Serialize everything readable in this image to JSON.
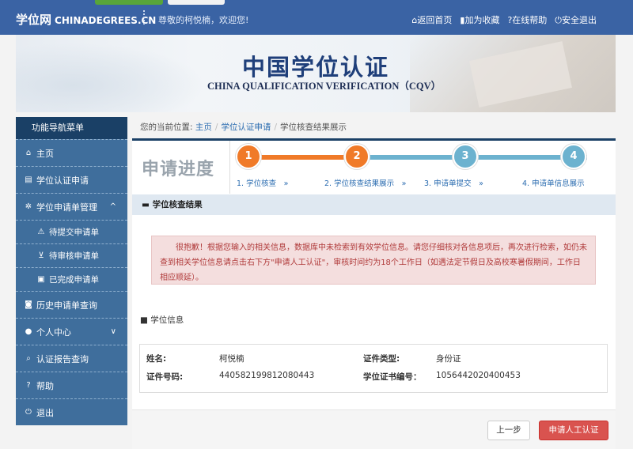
{
  "header": {
    "logo_cn": "学位网",
    "logo_en": "CHINADEGREES.CN",
    "greeting": "尊敬的柯悦楠，欢迎您!",
    "links": [
      {
        "icon": "home-icon",
        "glyph": "⌂",
        "label": "返回首页"
      },
      {
        "icon": "bookmark-icon",
        "glyph": "▮",
        "label": "加为收藏"
      },
      {
        "icon": "help-icon",
        "glyph": "?",
        "label": "在线帮助"
      },
      {
        "icon": "power-icon",
        "glyph": "⏻",
        "label": "安全退出"
      }
    ]
  },
  "banner": {
    "title_cn": "中国学位认证",
    "title_en": "CHINA QUALIFICATION VERIFICATION（CQV）"
  },
  "sidebar": {
    "heading": "功能导航菜单",
    "items": [
      {
        "label": "主页",
        "icon": "home-icon",
        "glyph": "⌂"
      },
      {
        "label": "学位认证申请",
        "icon": "document-icon",
        "glyph": "▤"
      },
      {
        "label": "学位申请单管理",
        "icon": "gear-icon",
        "glyph": "✲",
        "chevron": "^"
      },
      {
        "label": "待提交申请单",
        "icon": "warning-icon",
        "glyph": "⚠"
      },
      {
        "label": "待审核申请单",
        "icon": "cart-icon",
        "glyph": "⊻"
      },
      {
        "label": "已完成申请单",
        "icon": "briefcase-icon",
        "glyph": "▣"
      },
      {
        "label": "历史申请单查询",
        "icon": "camera-icon",
        "glyph": "◙"
      },
      {
        "label": "个人中心",
        "icon": "user-icon",
        "glyph": "●",
        "chevron": "∨"
      },
      {
        "label": "认证报告查询",
        "icon": "search-icon",
        "glyph": "⌕"
      },
      {
        "label": "帮助",
        "icon": "question-icon",
        "glyph": "?"
      },
      {
        "label": "退出",
        "icon": "power-icon",
        "glyph": "⏻"
      }
    ]
  },
  "breadcrumb": {
    "prefix": "您的当前位置:",
    "items": [
      "主页",
      "学位认证申请",
      "学位核查结果展示"
    ]
  },
  "progress": {
    "title": "申请进度",
    "steps": [
      {
        "num": "1",
        "label": "1. 学位核查　»",
        "color": "#f07a28"
      },
      {
        "num": "2",
        "label": "2. 学位核查结果展示　»",
        "color": "#f07a28"
      },
      {
        "num": "3",
        "label": "3. 申请单提交　»",
        "color": "#6cb2cf"
      },
      {
        "num": "4",
        "label": "4. 申请单信息展示",
        "color": "#6cb2cf"
      }
    ]
  },
  "result": {
    "heading": "学位核查结果",
    "heading_icon": "comment-icon",
    "alert": "很抱歉！根据您输入的相关信息，数据库中未检索到有效学位信息。请您仔细核对各信息项后，再次进行检索，如仍未查到相关学位信息请点击右下方\"申请人工认证\"，审核时间约为18个工作日（如遇法定节假日及高校寒暑假期间，工作日相应顺延）。"
  },
  "degree_info": {
    "title": "学位信息",
    "title_icon": "video-icon",
    "name_label": "姓名:",
    "name_value": "柯悦楠",
    "idtype_label": "证件类型:",
    "idtype_value": "身份证",
    "idno_label": "证件号码:",
    "idno_value": "440582199812080443",
    "certno_label": "学位证书编号：",
    "certno_value": "1056442020400453"
  },
  "buttons": {
    "prev": "上一步",
    "manual": "申请人工认证"
  }
}
